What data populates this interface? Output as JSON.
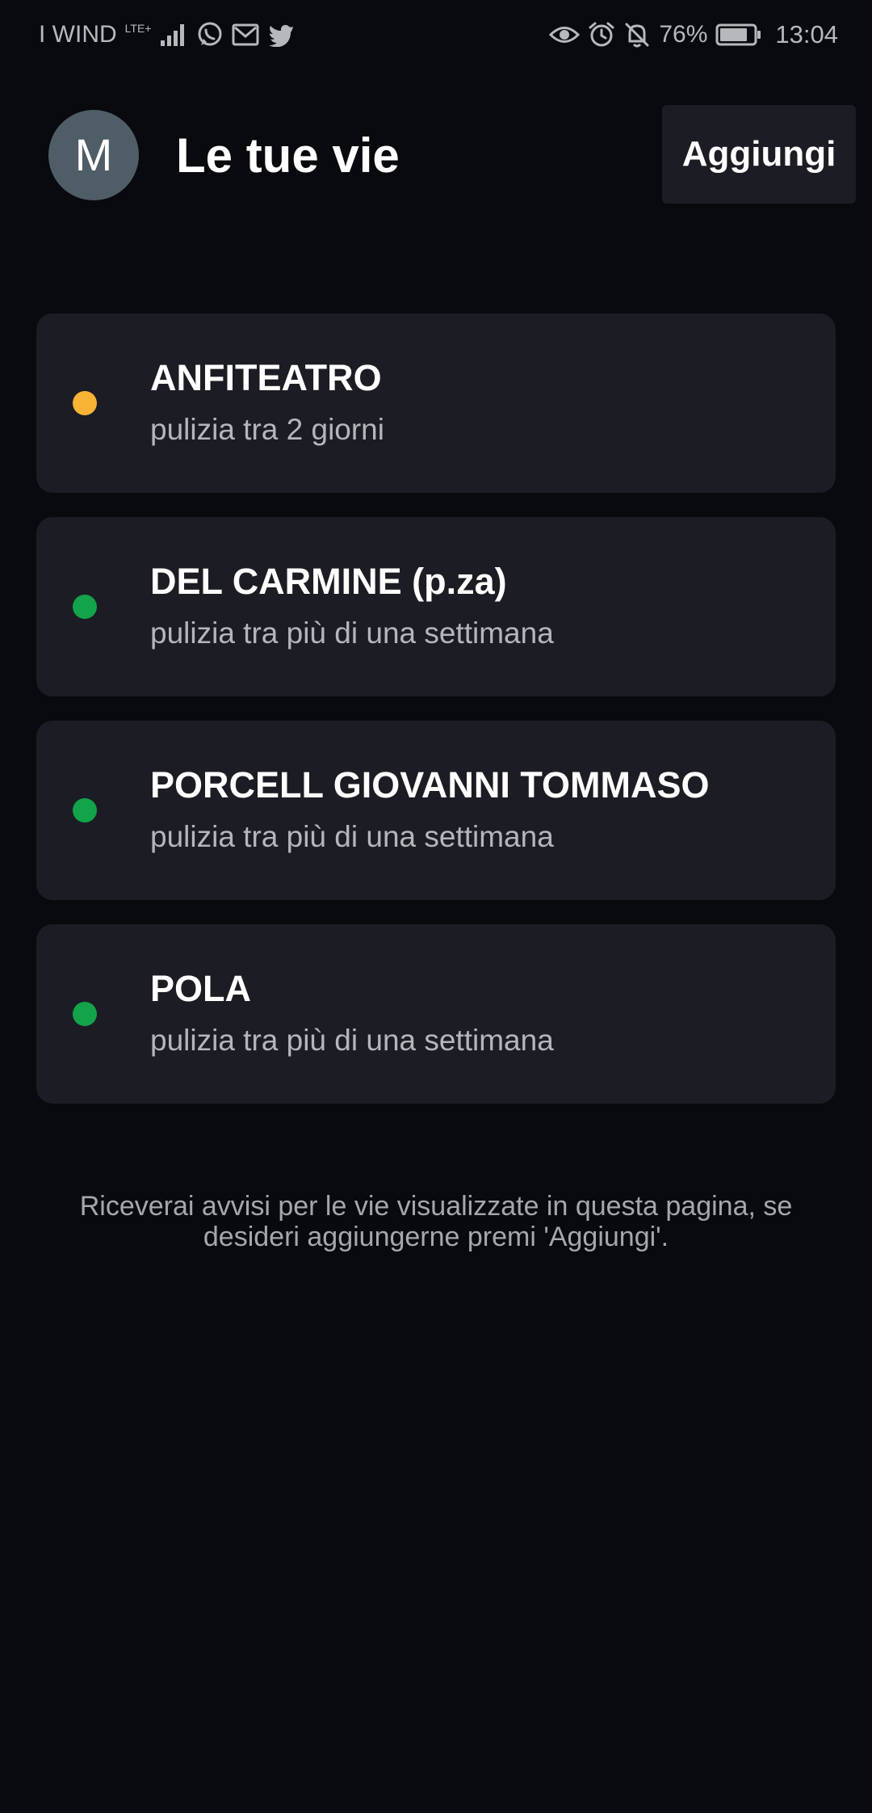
{
  "status_bar": {
    "carrier": "I WIND",
    "network": "LTE+",
    "battery": "76%",
    "time": "13:04",
    "icons_left": [
      "signal-icon",
      "whatsapp-icon",
      "gmail-icon",
      "twitter-icon"
    ],
    "icons_right": [
      "eye-icon",
      "alarm-icon",
      "notifications-off-icon",
      "battery-icon"
    ]
  },
  "header": {
    "avatar_letter": "M",
    "title": "Le tue vie",
    "add_label": "Aggiungi"
  },
  "streets": [
    {
      "name": "ANFITEATRO",
      "subtitle": "pulizia tra 2 giorni",
      "status": "soon",
      "dot_color": "#f8b334"
    },
    {
      "name": "DEL CARMINE (p.za)",
      "subtitle": "pulizia tra più di una settimana",
      "status": "ok",
      "dot_color": "#13a34a"
    },
    {
      "name": "PORCELL GIOVANNI TOMMASO",
      "subtitle": "pulizia tra più di una settimana",
      "status": "ok",
      "dot_color": "#13a34a"
    },
    {
      "name": "POLA",
      "subtitle": "pulizia tra più di una settimana",
      "status": "ok",
      "dot_color": "#13a34a"
    }
  ],
  "footer_note": "Riceverai avvisi per le vie visualizzate in questa pagina, se desideri aggiungerne premi 'Aggiungi'.",
  "colors": {
    "background": "#090a0e",
    "card": "#1c1d24",
    "warning": "#f8b334",
    "ok": "#13a34a"
  }
}
